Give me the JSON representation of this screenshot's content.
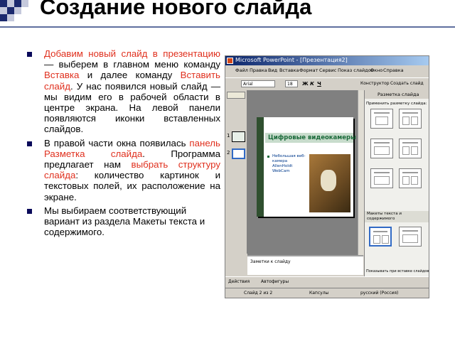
{
  "slide": {
    "title": "Создание нового слайда",
    "paragraphs": [
      {
        "segments": [
          {
            "text": "Добавим новый слайд в презентацию",
            "red": true
          },
          {
            "text": " — выберем в главном меню команду ",
            "red": false
          },
          {
            "text": "Вставка",
            "red": true
          },
          {
            "text": " и далее команду ",
            "red": false
          },
          {
            "text": "Вставить слайд",
            "red": true
          },
          {
            "text": ". У нас появился новый слайд — мы видим его в рабочей области в центре экрана. На левой панели появляются иконки вставленных слайдов.",
            "red": false
          }
        ]
      },
      {
        "segments": [
          {
            "text": "В правой части окна появилась ",
            "red": false
          },
          {
            "text": "панель Разметка слайда",
            "red": true
          },
          {
            "text": ". Программа предлагает нам ",
            "red": false
          },
          {
            "text": "выбрать структуру слайда",
            "red": true
          },
          {
            "text": ": количество картинок и текстовых полей, их расположение на экране.",
            "red": false
          }
        ]
      },
      {
        "segments": [
          {
            "text": "Мы выбираем соответствующий вариант из раздела Макеты текста и содержимого.",
            "red": false
          }
        ]
      }
    ]
  },
  "screenshot": {
    "window_title": "Microsoft PowerPoint - [Презентация2]",
    "menu": [
      "Файл",
      "Правка",
      "Вид",
      "Вставка",
      "Формат",
      "Сервис",
      "Показ слайдов",
      "Окно",
      "Справка"
    ],
    "font_name": "Arial",
    "font_size": "18",
    "toolbar_constructor": "Конструктор",
    "toolbar_create": "Создать слайд",
    "thumb_numbers": [
      "1",
      "2"
    ],
    "inner_slide_title": "Цифровые видеокамеры",
    "inner_slide_text": "Небольшая веб-камера AllenHoldt WebCam",
    "notes_placeholder": "Заметки к слайду",
    "task_pane_title": "Разметка слайда",
    "task_pane_apply": "Применить разметку слайда:",
    "task_pane_group": "Макеты текста и содержимого",
    "task_pane_footer": "Показывать при вставке слайдов",
    "draw_actions": "Действия",
    "draw_autoshapes": "Автофигуры",
    "status_slide": "Слайд 2 из 2",
    "status_design": "Капсулы",
    "status_lang": "русский (Россия)"
  }
}
